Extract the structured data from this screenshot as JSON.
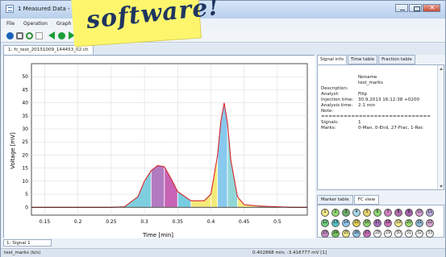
{
  "window": {
    "title": "1 Measured Data - C:\\_KINOVIC"
  },
  "menu": [
    "File",
    "Operation",
    "Graph"
  ],
  "file_tab": "1: fc_test_20131009_144453_02.ch",
  "sticky_note": {
    "text": "software!"
  },
  "info_tabs": [
    "Signal info",
    "Time table",
    "Fraction table"
  ],
  "info": {
    "name_key": "",
    "name_value": "Noname",
    "marks_value": "test_marks",
    "description_key": "Description:",
    "analyst_key": "Analyst:",
    "analyst_value": "Filip",
    "injection_key": "Injection time:",
    "injection_value": "30.9.2013 16:12:38 +0200",
    "analysis_key": "Analysis time:",
    "analysis_value": "2.1 min",
    "note_key": "Note:",
    "separator": "=============================",
    "signals_key": "Signals:",
    "signals_value": "1",
    "marks_key": "Marks:",
    "marks_summary": "0-Man, 0-End, 27-Frac, 1-Rec"
  },
  "marker_tabs": [
    "Marker table",
    "FC view"
  ],
  "fc_view": [
    {
      "n": "1",
      "color": "#f2e889"
    },
    {
      "n": "2",
      "color": "#91d66f"
    },
    {
      "n": "3",
      "color": "#6aab6b"
    },
    {
      "n": "4",
      "color": "#a7d8ea"
    },
    {
      "n": "5",
      "color": "#ead66f"
    },
    {
      "n": "6",
      "color": "#8dd970"
    },
    {
      "n": "7",
      "color": "#cf7fbe"
    },
    {
      "n": "8",
      "color": "#b36bae"
    },
    {
      "n": "9",
      "color": "#a35fa9"
    },
    {
      "n": "10",
      "color": "#d69fd6"
    },
    {
      "n": "11",
      "color": "#b7a7d8"
    },
    {
      "n": "12",
      "color": "#6fcf7d"
    },
    {
      "n": "13",
      "color": "#58c0c8"
    },
    {
      "n": "14",
      "color": "#8fc5ef"
    },
    {
      "n": "15",
      "color": "#e2cf54"
    },
    {
      "n": "16",
      "color": "#8ed26f"
    },
    {
      "n": "17",
      "color": "#a36bb9"
    },
    {
      "n": "18",
      "color": "#cc70b8"
    },
    {
      "n": "19",
      "color": "#f2e889"
    },
    {
      "n": "20",
      "color": "#9bdc73"
    },
    {
      "n": "21",
      "color": "#8fbdd6"
    },
    {
      "n": "22",
      "color": "#d6a3d1"
    },
    {
      "n": "23",
      "color": "#c58ac6"
    },
    {
      "n": "24",
      "color": "#76c65d"
    },
    {
      "n": "25",
      "color": "#f2e889"
    },
    {
      "n": "26",
      "color": "#8fc4e6"
    },
    {
      "n": "27",
      "color": "#c56fb8"
    },
    {
      "n": "28",
      "color": "#ffffff"
    },
    {
      "n": "29",
      "color": "#ffffff"
    },
    {
      "n": "30",
      "color": "#ffffff"
    },
    {
      "n": "31",
      "color": "#ffffff"
    },
    {
      "n": "32",
      "color": "#ffffff"
    },
    {
      "n": "33",
      "color": "#ffffff"
    }
  ],
  "bottom_tab": "1: Signal 1",
  "status": {
    "left": "test_marks (b/s)",
    "right": "0.402868 min; -3.416777 mV  [1]"
  },
  "chart_data": {
    "type": "area",
    "xlabel": "Time [min]",
    "ylabel": "Voltage [mV]",
    "xlim": [
      0.13,
      0.545
    ],
    "ylim": [
      -3,
      55
    ],
    "xticks": [
      "0.15",
      "0.2",
      "0.25",
      "0.3",
      "0.35",
      "0.4",
      "0.45",
      "0.5"
    ],
    "yticks": [
      "0",
      "5",
      "10",
      "15",
      "20",
      "25",
      "30",
      "35",
      "40",
      "45",
      "50"
    ],
    "x": [
      0.13,
      0.15,
      0.17,
      0.2,
      0.23,
      0.25,
      0.27,
      0.29,
      0.3,
      0.31,
      0.32,
      0.33,
      0.34,
      0.35,
      0.37,
      0.39,
      0.4,
      0.41,
      0.415,
      0.42,
      0.425,
      0.43,
      0.44,
      0.45,
      0.47,
      0.5,
      0.52,
      0.545
    ],
    "y": [
      0,
      0,
      0,
      0,
      0,
      0,
      0.2,
      4,
      10,
      14,
      16,
      15.5,
      11,
      6,
      2.5,
      2.5,
      5,
      20,
      33,
      40,
      32,
      18,
      4,
      1,
      0.5,
      0.2,
      0,
      0
    ],
    "fractions": [
      {
        "start": 0.13,
        "end": 0.15,
        "color": "#7fcf7a"
      },
      {
        "start": 0.15,
        "end": 0.17,
        "color": "#7fcf7a"
      },
      {
        "start": 0.17,
        "end": 0.23,
        "color": "#f1e97e"
      },
      {
        "start": 0.23,
        "end": 0.25,
        "color": "#f1e97e"
      },
      {
        "start": 0.25,
        "end": 0.31,
        "color": "#7fcedf"
      },
      {
        "start": 0.31,
        "end": 0.33,
        "color": "#b27bc1"
      },
      {
        "start": 0.33,
        "end": 0.35,
        "color": "#c863b5"
      },
      {
        "start": 0.35,
        "end": 0.37,
        "color": "#77cde1"
      },
      {
        "start": 0.37,
        "end": 0.4,
        "color": "#f4ea7a"
      },
      {
        "start": 0.4,
        "end": 0.41,
        "color": "#f4ea7a"
      },
      {
        "start": 0.41,
        "end": 0.425,
        "color": "#88c9ee"
      },
      {
        "start": 0.425,
        "end": 0.44,
        "color": "#92d7d8"
      },
      {
        "start": 0.44,
        "end": 0.47,
        "color": "#f3eb81"
      },
      {
        "start": 0.47,
        "end": 0.5,
        "color": "#7fcf7a"
      },
      {
        "start": 0.5,
        "end": 0.52,
        "color": "#7fcf7a"
      },
      {
        "start": 0.52,
        "end": 0.545,
        "color": "#7fcf7a"
      }
    ]
  }
}
